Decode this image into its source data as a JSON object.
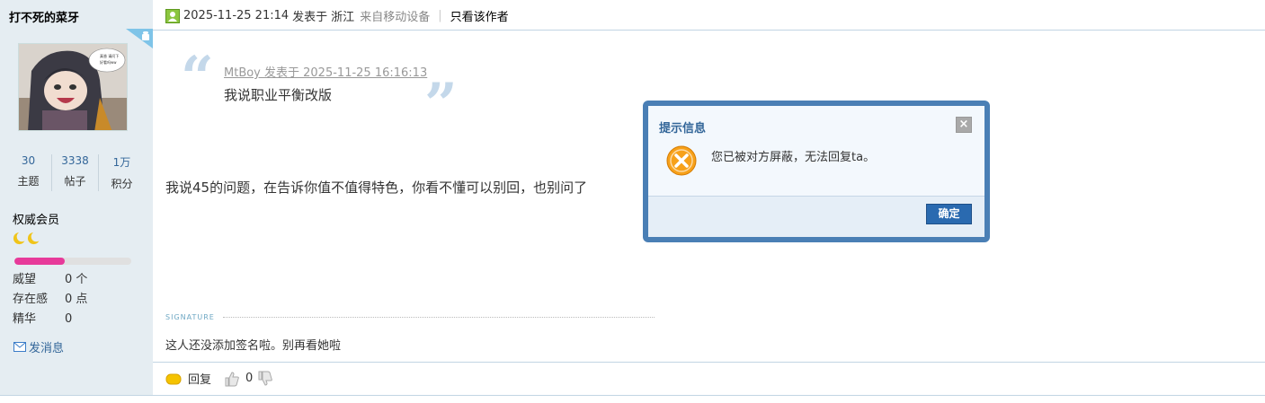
{
  "user": {
    "name": "打不死的菜牙",
    "avatar_bubble": "真香 请问下\n好看吗ww",
    "stats": [
      {
        "value": "30",
        "label": "主题"
      },
      {
        "value": "3338",
        "label": "帖子"
      },
      {
        "value": "1万",
        "label": "积分"
      }
    ],
    "rank": "权威会员",
    "exp_fraction": 0.43,
    "attributes": [
      {
        "key": "威望",
        "value": "0 个"
      },
      {
        "key": "存在感",
        "value": "0 点"
      },
      {
        "key": "精华",
        "value": "0"
      }
    ],
    "send_message": "发消息"
  },
  "post": {
    "datetime": "2025-11-25 21:14",
    "posted_at": "发表于",
    "location": "浙江",
    "from_device": "来自移动设备",
    "separator": "|",
    "only_author": "只看该作者",
    "quote": {
      "author_line": "MtBoy 发表于 2025-11-25 16:16:13",
      "text": "我说职业平衡改版"
    },
    "body": "我说45的问题，在告诉你值不值得特色，你看不懂可以别回，也别问了",
    "signature_label": "SIGNATURE",
    "signature": "这人还没添加签名啦。别再看她啦",
    "reply_label": "回复",
    "like_count": "0"
  },
  "dialog": {
    "title": "提示信息",
    "close": "×",
    "message": "您已被对方屏蔽，无法回复ta。",
    "ok_label": "确定"
  },
  "colors": {
    "sidebar_bg": "#e5edf2",
    "link_blue": "#336699",
    "dialog_border": "#4a7fb5",
    "exp_pink": "#e73a9a"
  }
}
